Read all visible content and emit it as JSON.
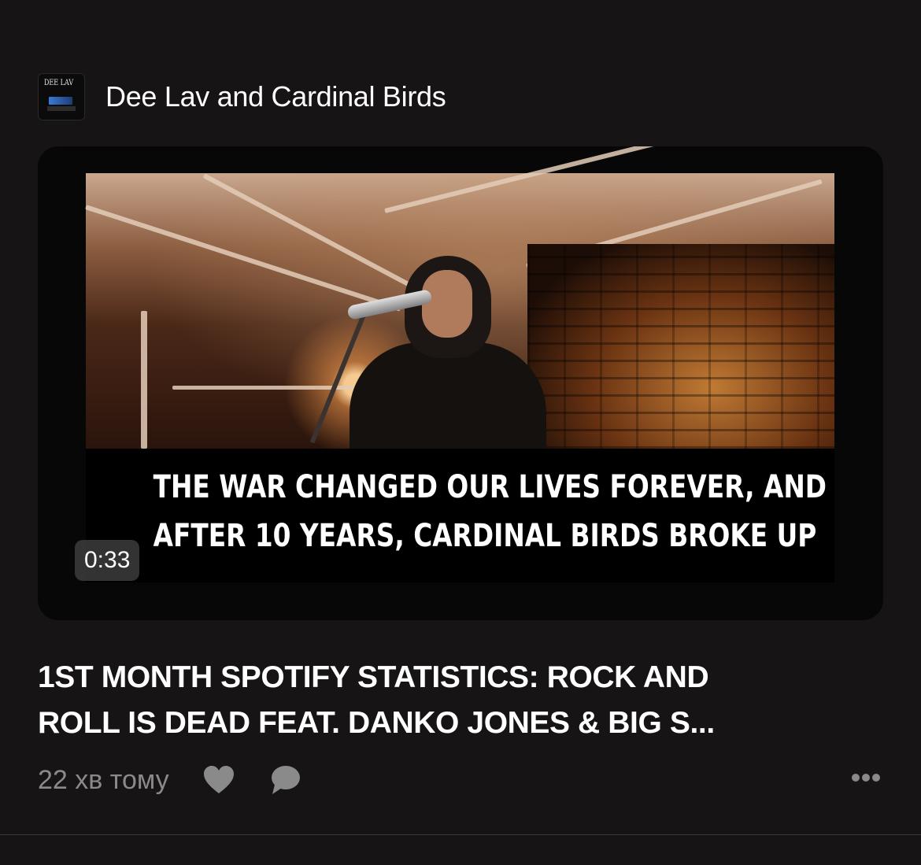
{
  "channel": {
    "name": "Dee Lav and Cardinal Birds",
    "avatar_icon": "band-logo-avatar",
    "avatar_text": "DEE LAV"
  },
  "video": {
    "caption_line1": "THE WAR CHANGED OUR LIVES FOREVER, AND",
    "caption_line2": "AFTER 10 YEARS, CARDINAL BIRDS BROKE UP",
    "duration": "0:33"
  },
  "post": {
    "title_line1": "1ST MONTH SPOTIFY STATISTICS: ROCK AND",
    "title_line2": "ROLL IS DEAD FEAT. DANKO JONES & BIG S...",
    "timestamp": "22 хв тому"
  },
  "actions": {
    "like_icon": "heart-icon",
    "comment_icon": "comment-bubble-icon",
    "more_icon": "more-dots-icon"
  },
  "colors": {
    "background": "#161414",
    "secondary_text": "#8a8a8a",
    "icon": "#8a8a8a"
  }
}
